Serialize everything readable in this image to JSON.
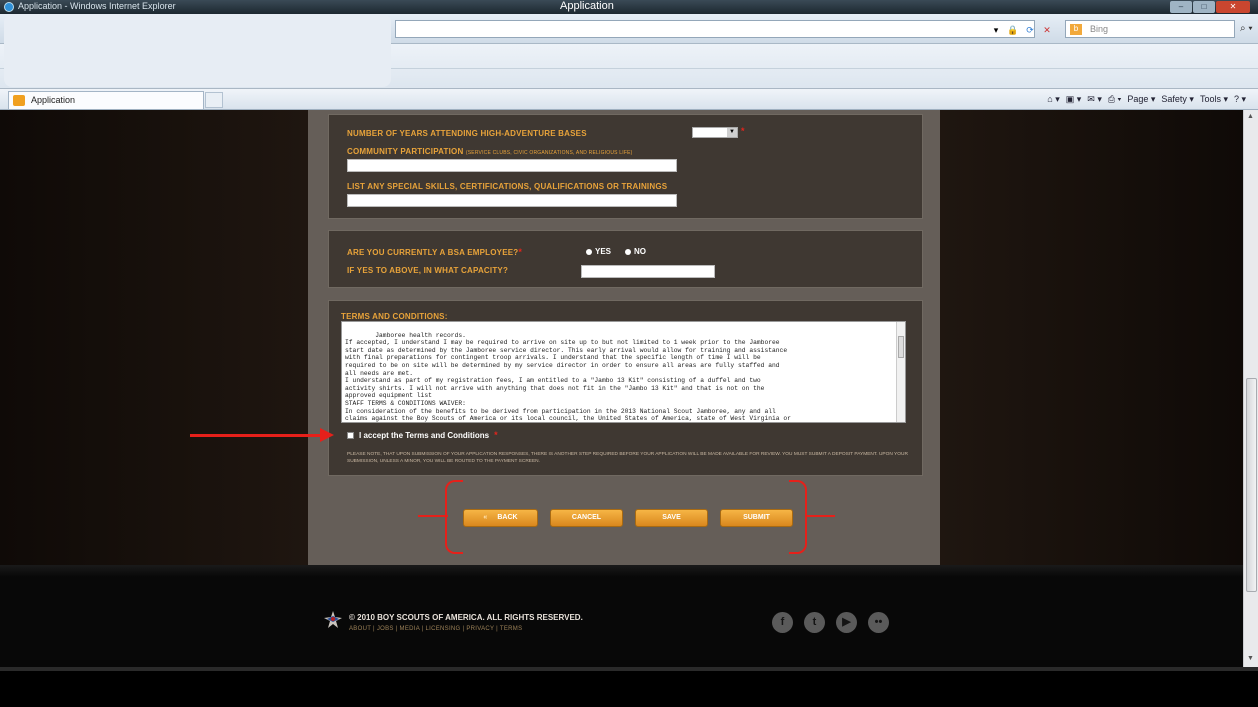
{
  "browser": {
    "window_title": "Application - Windows Internet Explorer",
    "site_title": "Application",
    "search_provider": "Bing",
    "tab_label": "Application",
    "command_bar": [
      "Page ▾",
      "Safety ▾",
      "Tools ▾"
    ]
  },
  "form": {
    "years_label": "NUMBER OF YEARS ATTENDING HIGH-ADVENTURE BASES",
    "community_label": "COMMUNITY PARTICIPATION",
    "community_hint": "(SERVICE CLUBS, CIVIC ORGANIZATIONS, AND RELIGIOUS LIFE)",
    "skills_label": "LIST ANY SPECIAL SKILLS, CERTIFICATIONS, QUALIFICATIONS OR TRAININGS",
    "employee_label": "ARE YOU CURRENTLY A BSA EMPLOYEE?",
    "yes_label": "YES",
    "no_label": "NO",
    "capacity_label": "IF YES TO ABOVE, IN WHAT CAPACITY?",
    "required_mark": "*",
    "terms_heading": "TERMS AND CONDITIONS:",
    "terms_text": "Jamboree health records.\nIf accepted, I understand I may be required to arrive on site up to but not limited to 1 week prior to the Jamboree\nstart date as determined by the Jamboree service director. This early arrival would allow for training and assistance\nwith final preparations for contingent troop arrivals. I understand that the specific length of time I will be\nrequired to be on site will be determined by my service director in order to ensure all areas are fully staffed and\nall needs are met.\nI understand as part of my registration fees, I am entitled to a \"Jambo 13 Kit\" consisting of a duffel and two\nactivity shirts. I will not arrive with anything that does not fit in the \"Jambo 13 Kit\" and that is not on the\napproved equipment list\nSTAFF TERMS & CONDITIONS WAIVER:\nIn consideration of the benefits to be derived from participation in the 2013 National Scout Jamboree, any and all\nclaims against the Boy Scouts of America or its local council, the United States of America, state of West Virginia or",
    "accept_label": "I accept the Terms and Conditions",
    "note": "PLEASE NOTE, THAT UPON SUBMISSION OF YOUR APPLICATION RESPONSES, THERE IS ANOTHER STEP REQUIRED BEFORE YOUR APPLICATION WILL BE MADE AVAILABLE FOR REVIEW. YOU MUST SUBMIT A DEPOSIT PAYMENT. UPON YOUR SUBMISSION, UNLESS A MINOR, YOU WILL BE ROUTED TO THE PAYMENT SCREEN."
  },
  "buttons": {
    "back_glyph": "«",
    "back": "BACK",
    "cancel": "CANCEL",
    "save": "SAVE",
    "submit": "SUBMIT"
  },
  "footer": {
    "copyright": "© 2010 BOY SCOUTS OF AMERICA. ALL RIGHTS RESERVED.",
    "links": "ABOUT | JOBS | MEDIA | LICENSING | PRIVACY | TERMS",
    "social": [
      "facebook-icon",
      "twitter-icon",
      "youtube-icon",
      "flickr-icon"
    ]
  },
  "colors": {
    "accent_orange": "#e8a33a",
    "annotation_red": "#e6201a",
    "panel_bg": "#3f3832"
  }
}
